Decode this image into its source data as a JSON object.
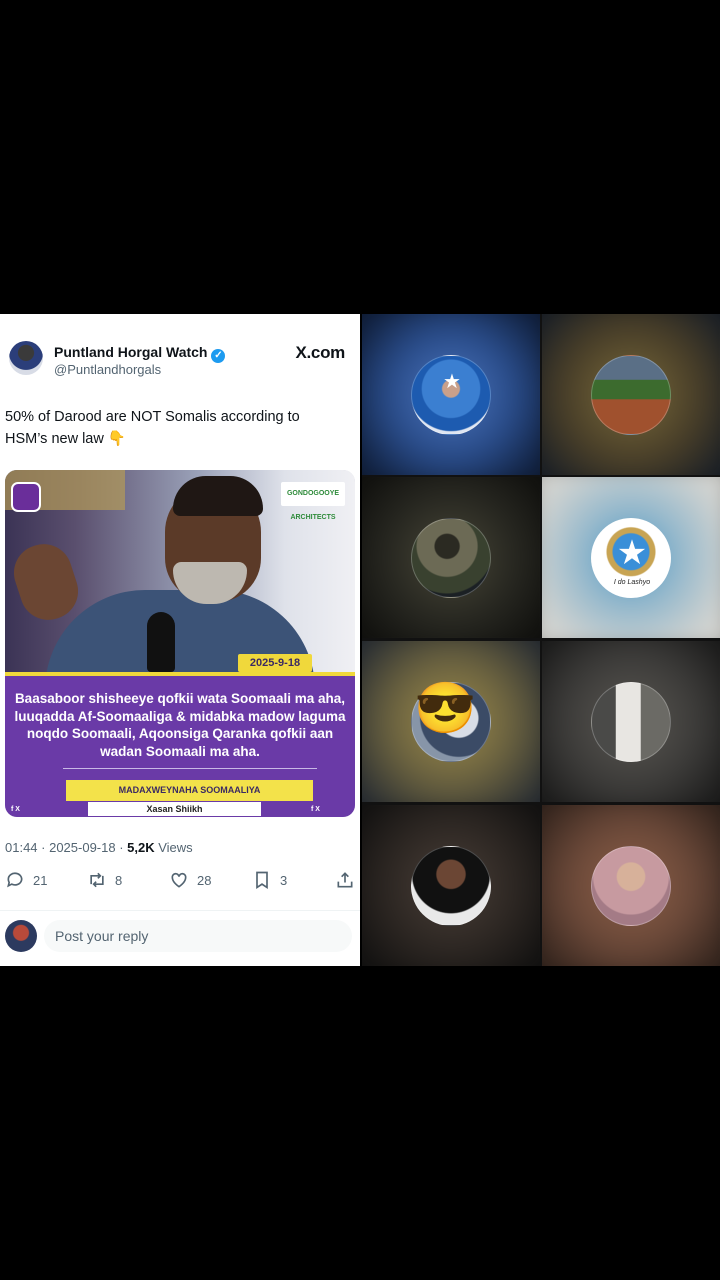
{
  "tweet": {
    "author_name": "Puntland Horgal Watch",
    "verified_mark": "✓",
    "handle": "@Puntlandhorgals",
    "site": "X.com",
    "text": "50% of Darood are NOT Somalis according to HSM’s new law 👇",
    "media": {
      "brand": "GONDOGOOYE ARCHITECTS",
      "date": "2025-9-18",
      "caption": "Baasaboor shisheeye qofkii wata Soomaali ma aha, luuqadda Af-Soomaaliga & midabka madow laguma noqdo Soomaali, Aqoonsiga Qaranka qofkii aan wadan Soomaali ma aha.",
      "title_label": "MADAXWEYNAHA SOOMAALIYA",
      "name_label": "Xasan Shiikh",
      "footer_mark": "f X"
    },
    "time": "01:44 · 2025-09-18 · ",
    "views_count": "5,2K",
    "views_label": " Views",
    "stats": {
      "replies": "21",
      "reposts": "8",
      "likes": "28",
      "bookmarks": "3"
    },
    "reply_placeholder": "Post your reply"
  },
  "call_grid": {
    "tiles": [
      {
        "avatar": "masked-person-somali-flag-avatar",
        "tint": "#2b4f8f"
      },
      {
        "avatar": "village-landscape-avatar",
        "tint": "#5a5030"
      },
      {
        "avatar": "soldier-in-water-avatar",
        "tint": "#2a2a22"
      },
      {
        "avatar": "somali-flag-emblem-avatar",
        "tint": "#8fb6cc",
        "ribbon": "I do Lashyo",
        "star": "★"
      },
      {
        "avatar": "sunglasses-emoji-avatar",
        "tint": "#6d6440",
        "emoji": "😎"
      },
      {
        "avatar": "man-standing-avatar",
        "tint": "#3d3c3a"
      },
      {
        "avatar": "man-with-sunglasses-avatar",
        "tint": "#3a302a"
      },
      {
        "avatar": "woman-headscarf-avatar",
        "tint": "#6d4a3a"
      }
    ]
  }
}
